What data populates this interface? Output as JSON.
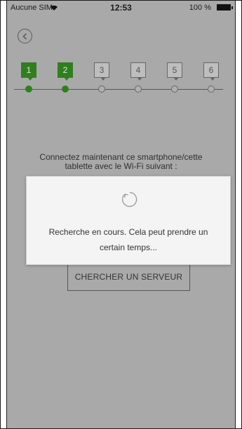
{
  "status_bar": {
    "carrier": "Aucune SIM",
    "time": "12:53",
    "battery_percent": "100 %"
  },
  "stepper": {
    "steps": [
      {
        "label": "1",
        "state": "done"
      },
      {
        "label": "2",
        "state": "done"
      },
      {
        "label": "3",
        "state": "todo"
      },
      {
        "label": "4",
        "state": "todo"
      },
      {
        "label": "5",
        "state": "todo"
      },
      {
        "label": "6",
        "state": "todo"
      }
    ]
  },
  "main": {
    "instruction": "Connectez maintenant ce smartphone/cette tablette avec le Wi-Fi suivant :",
    "search_button": "CHERCHER UN SERVEUR"
  },
  "modal": {
    "message": "Recherche en cours. Cela peut prendre un certain temps..."
  },
  "colors": {
    "accent": "#2f7f1f",
    "background": "#a9a9a9",
    "modal_background": "#f4f4f4"
  }
}
